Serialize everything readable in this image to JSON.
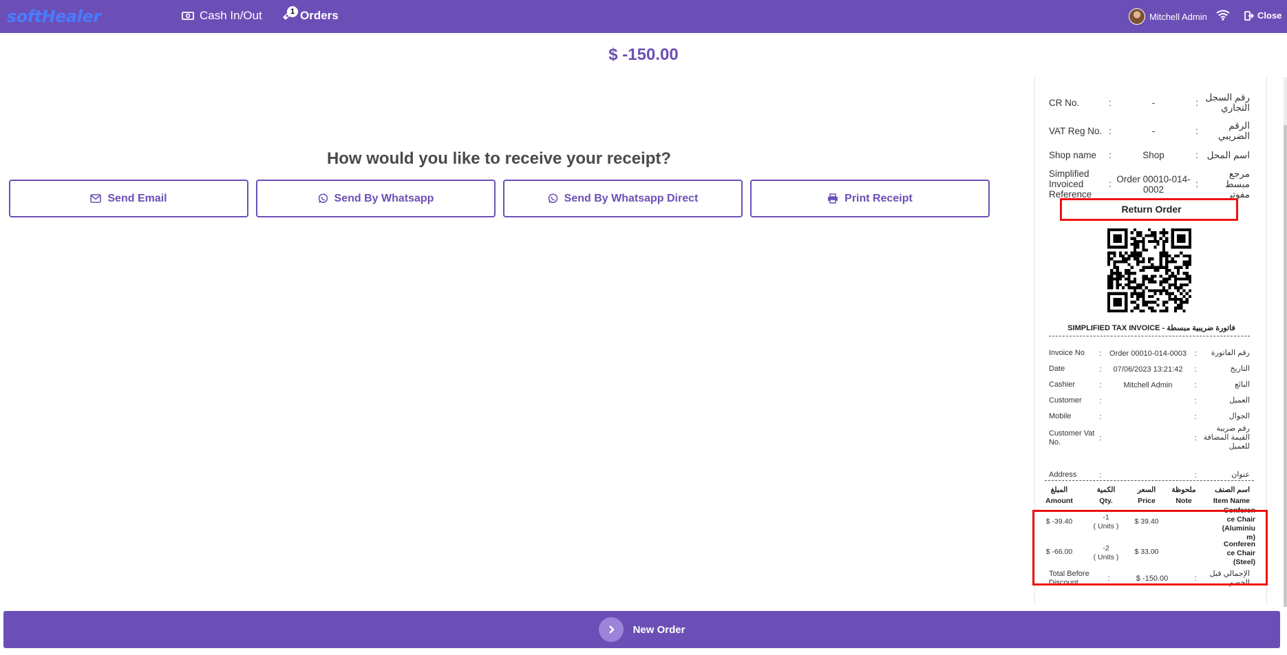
{
  "topbar": {
    "logo": "softHealer",
    "cash_label": "Cash In/Out",
    "orders_label": "Orders",
    "orders_badge": "1",
    "user_name": "Mitchell Admin",
    "close_label": "Close"
  },
  "amount": "$ -150.00",
  "receipt_prompt": {
    "question": "How would you like to receive your receipt?",
    "buttons": {
      "email": "Send Email",
      "whatsapp": "Send By Whatsapp",
      "whatsapp_direct": "Send By Whatsapp Direct",
      "print": "Print Receipt"
    }
  },
  "receipt": {
    "header_rows": [
      {
        "key": "CR No.",
        "value": "-",
        "arabic": "رقم السجل التجاري"
      },
      {
        "key": "VAT Reg No.",
        "value": "-",
        "arabic": "الرقم الضريبي"
      },
      {
        "key": "Shop name",
        "value": "Shop",
        "arabic": "اسم المحل"
      },
      {
        "key": "Simplified Invoiced Reference",
        "value": "Order 00010-014-0002",
        "arabic": "مرجع مبسط مفوتر"
      }
    ],
    "return_label": "Return Order",
    "tax_title": "SIMPLIFIED TAX INVOICE - فاتورة ضريبية مبسطة",
    "info_rows": [
      {
        "key": "Invoice No",
        "value": "Order 00010-014-0003",
        "arabic": "رقم الفاتورة"
      },
      {
        "key": "Date",
        "value": "07/06/2023 13:21:42",
        "arabic": "التاريخ"
      },
      {
        "key": "Cashier",
        "value": "Mitchell Admin",
        "arabic": "البائع"
      },
      {
        "key": "Customer",
        "value": "",
        "arabic": "العميل"
      },
      {
        "key": "Mobile",
        "value": "",
        "arabic": "الجوال"
      },
      {
        "key": "Customer Vat No.",
        "value": "",
        "arabic": "رقم ضريبة القيمة المضافة للعميل"
      },
      {
        "key": "Address",
        "value": "",
        "arabic": "عنوان"
      }
    ],
    "columns": [
      {
        "ar": "المبلغ",
        "en": "Amount"
      },
      {
        "ar": "الكمية",
        "en": "Qty."
      },
      {
        "ar": "السعر",
        "en": "Price"
      },
      {
        "ar": "ملحوظة",
        "en": "Note"
      },
      {
        "ar": "اسم الصنف",
        "en": "Item Name"
      }
    ],
    "items": [
      {
        "amount": "$ -39.40",
        "qty": "-1",
        "unit": "( Units )",
        "price": "$ 39.40",
        "note": "",
        "name": "Conference Chair (Aluminium)"
      },
      {
        "amount": "$ -66.00",
        "qty": "-2",
        "unit": "( Units )",
        "price": "$ 33.00",
        "note": "",
        "name": "Conference Chair (Steel)"
      }
    ],
    "total": {
      "key": "Total Before Discount",
      "value": "$ -150.00",
      "arabic": "الإجمالي قبل الخصم"
    }
  },
  "footer": {
    "new_order": "New Order"
  }
}
